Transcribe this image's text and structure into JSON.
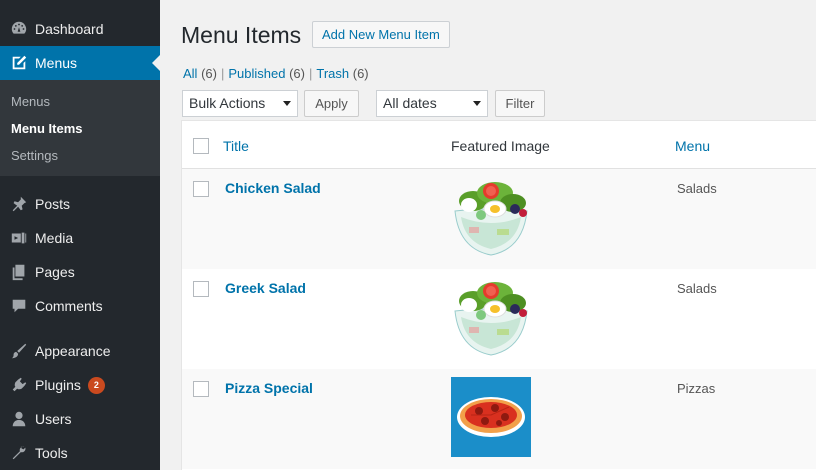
{
  "sidebar": {
    "dashboard": {
      "label": "Dashboard",
      "icon": "dashboard-icon"
    },
    "menus": {
      "label": "Menus",
      "icon": "edit-icon"
    },
    "submenu": [
      "Menus",
      "Menu Items",
      "Settings"
    ],
    "posts": {
      "label": "Posts",
      "icon": "pin-icon"
    },
    "media": {
      "label": "Media",
      "icon": "media-icon"
    },
    "pages": {
      "label": "Pages",
      "icon": "pages-icon"
    },
    "comments": {
      "label": "Comments",
      "icon": "comments-icon"
    },
    "appearance": {
      "label": "Appearance",
      "icon": "brush-icon"
    },
    "plugins": {
      "label": "Plugins",
      "icon": "plug-icon",
      "badge": "2"
    },
    "users": {
      "label": "Users",
      "icon": "user-icon"
    },
    "tools": {
      "label": "Tools",
      "icon": "wrench-icon"
    }
  },
  "header": {
    "title": "Menu Items",
    "add_new": "Add New Menu Item"
  },
  "filters": {
    "all": "All",
    "all_count": "(6)",
    "published": "Published",
    "published_count": "(6)",
    "trash": "Trash",
    "trash_count": "(6)",
    "bulk_actions": "Bulk Actions",
    "apply": "Apply",
    "dates": "All dates",
    "filter": "Filter"
  },
  "table": {
    "columns": {
      "title": "Title",
      "featured_image": "Featured Image",
      "menu": "Menu"
    },
    "rows": [
      {
        "title": "Chicken Salad",
        "menu": "Salads",
        "image": "salad"
      },
      {
        "title": "Greek Salad",
        "menu": "Salads",
        "image": "salad"
      },
      {
        "title": "Pizza Special",
        "menu": "Pizzas",
        "image": "pizza"
      }
    ]
  },
  "colors": {
    "sidebar_bg": "#23282d",
    "accent": "#0073aa",
    "badge": "#ca4a1f"
  }
}
